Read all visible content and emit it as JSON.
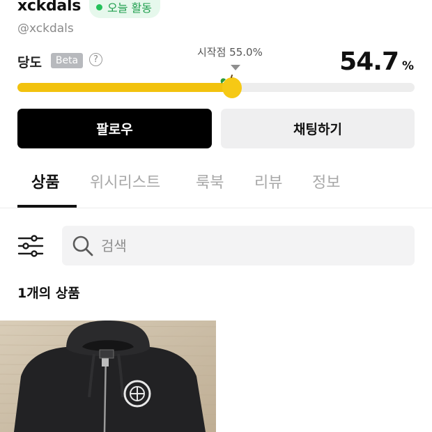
{
  "profile": {
    "username": "xckdals",
    "activity_badge": "오늘 활동",
    "handle": "@xckdals"
  },
  "sweetness": {
    "label": "당도",
    "beta_badge": "Beta",
    "help_glyph": "?",
    "start_label": "시작점 55.0%",
    "start_value": 55.0,
    "score": "54.7",
    "score_unit": "%",
    "value_percent": 54.7,
    "bar_color": "#f2c20e"
  },
  "actions": {
    "follow_label": "팔로우",
    "chat_label": "채팅하기"
  },
  "tabs": [
    {
      "label": "상품",
      "active": true
    },
    {
      "label": "위시리스트",
      "active": false
    },
    {
      "label": "룩북",
      "active": false
    },
    {
      "label": "리뷰",
      "active": false
    },
    {
      "label": "정보",
      "active": false
    }
  ],
  "search": {
    "placeholder": "검색",
    "value": ""
  },
  "products": {
    "count_label": "1개의 상품",
    "items": [
      {
        "image_icon": "black-zip-hoodie-photo"
      }
    ]
  },
  "colors": {
    "accent_green": "#25c15a",
    "primary_button": "#000000",
    "secondary_button": "#efeff0"
  }
}
